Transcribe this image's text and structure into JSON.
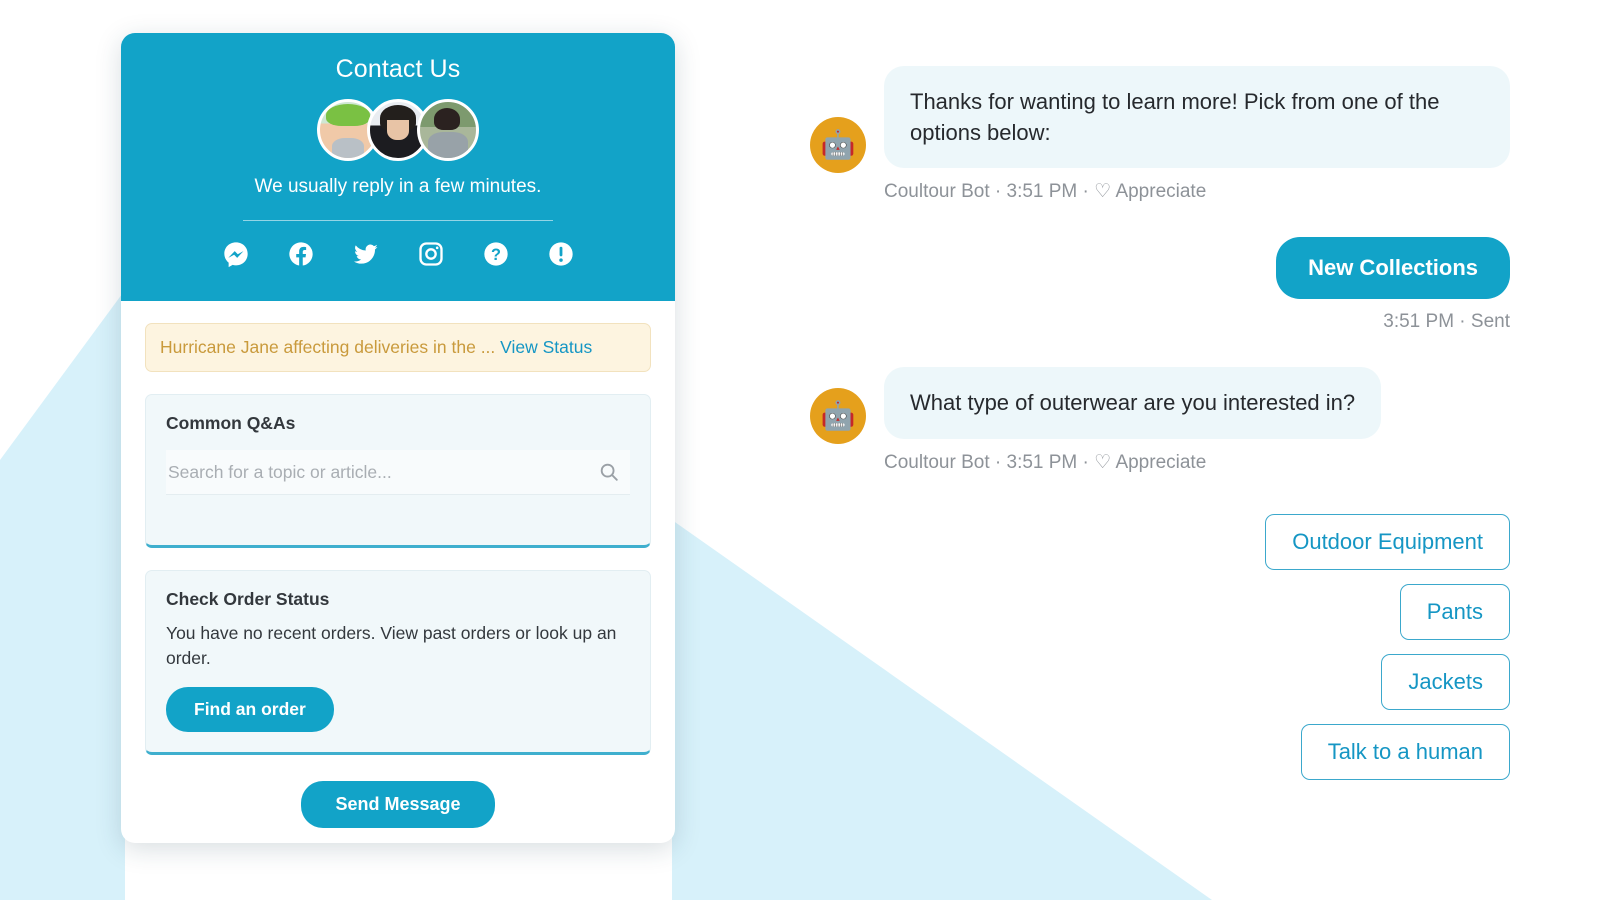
{
  "theme": {
    "accent": "#12A3C8",
    "bubble_in_bg": "#EDF7FA",
    "banner_bg": "#FDF4E0",
    "banner_text": "#C99A3C",
    "card_bg": "#F1F8FA",
    "wedge": "#D7F1FA",
    "bot_avatar_bg": "#E5A01C",
    "meta_text": "#8D9298"
  },
  "panel": {
    "header": {
      "title": "Contact Us",
      "reply_note": "We usually reply in a few minutes.",
      "avatars": [
        {
          "name": "agent-avatar-1"
        },
        {
          "name": "agent-avatar-2"
        },
        {
          "name": "agent-avatar-3"
        }
      ],
      "social_icons": [
        {
          "name": "messenger-icon",
          "label": "Messenger"
        },
        {
          "name": "facebook-icon",
          "label": "Facebook"
        },
        {
          "name": "twitter-icon",
          "label": "Twitter"
        },
        {
          "name": "instagram-icon",
          "label": "Instagram"
        },
        {
          "name": "help-icon",
          "label": "Help"
        },
        {
          "name": "alert-icon",
          "label": "Alert"
        }
      ]
    },
    "banner": {
      "text": "Hurricane Jane affecting deliveries in the ...",
      "link_label": "View Status"
    },
    "qa_card": {
      "title": "Common Q&As",
      "search_placeholder": "Search for a topic or article...",
      "search_value": "",
      "search_icon": "search-icon"
    },
    "order_card": {
      "title": "Check Order Status",
      "body": "You have no recent orders. View past orders or look up an order.",
      "button_label": "Find an order"
    },
    "send_button_label": "Send Message"
  },
  "chat": {
    "messages": [
      {
        "direction": "incoming",
        "avatar_icon": "robot-icon",
        "avatar_glyph": "🤖",
        "text": "Thanks for wanting to learn more! Pick from one of the options below:",
        "sender": "Coultour Bot",
        "time": "3:51 PM",
        "separator": "·",
        "reaction_icon": "heart-icon",
        "reaction_label": "Appreciate",
        "meta": "Coultour Bot · 3:51 PM ·"
      },
      {
        "direction": "outgoing",
        "text": "New Collections",
        "time": "3:51 PM",
        "status": "Sent",
        "meta": "3:51 PM · Sent"
      },
      {
        "direction": "incoming",
        "avatar_icon": "robot-icon",
        "avatar_glyph": "🤖",
        "text": "What type of outerwear are you interested in?",
        "sender": "Coultour Bot",
        "time": "3:51 PM",
        "separator": "·",
        "reaction_icon": "heart-icon",
        "reaction_label": "Appreciate",
        "meta": "Coultour Bot · 3:51 PM ·"
      }
    ],
    "quick_replies": [
      {
        "label": "Outdoor Equipment"
      },
      {
        "label": "Pants"
      },
      {
        "label": "Jackets"
      },
      {
        "label": "Talk to a human"
      }
    ]
  }
}
